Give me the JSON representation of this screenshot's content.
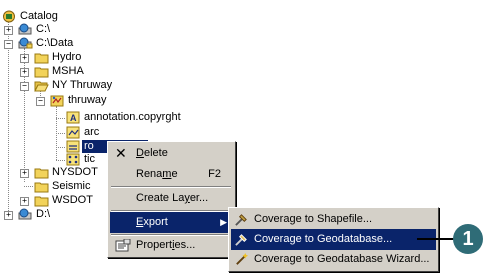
{
  "tree": {
    "root": "Catalog",
    "c_drive": "C:\\",
    "c_data": "C:\\Data",
    "hydro": "Hydro",
    "msha": "MSHA",
    "ny_thruway": "NY Thruway",
    "thruway": "thruway",
    "annotation": "annotation.copyrght",
    "arc": "arc",
    "route_selected": "ro",
    "tic": "tic",
    "nysdot": "NYSDOT",
    "seismic": "Seismic",
    "wsdot": "WSDOT",
    "d_drive": "D:\\"
  },
  "context_menu": {
    "delete": {
      "pre": "",
      "u": "D",
      "post": "elete"
    },
    "rename": {
      "pre": "Rena",
      "u": "m",
      "post": "e",
      "shortcut": "F2"
    },
    "create_layer": {
      "pre": "Create La",
      "u": "y",
      "post": "er..."
    },
    "export": {
      "pre": "",
      "u": "E",
      "post": "xport"
    },
    "properties": {
      "pre": "Propert",
      "u": "i",
      "post": "es..."
    }
  },
  "submenu": {
    "to_shapefile": "Coverage to Shapefile...",
    "to_geodatabase": "Coverage to Geodatabase...",
    "to_geodatabase_wizard": "Coverage to Geodatabase Wizard..."
  },
  "callout": {
    "number": "1"
  },
  "colors": {
    "highlight": "#0a246a",
    "menu_face": "#d4d0c8",
    "folder": "#f2d35a",
    "callout": "#2f6c77"
  }
}
